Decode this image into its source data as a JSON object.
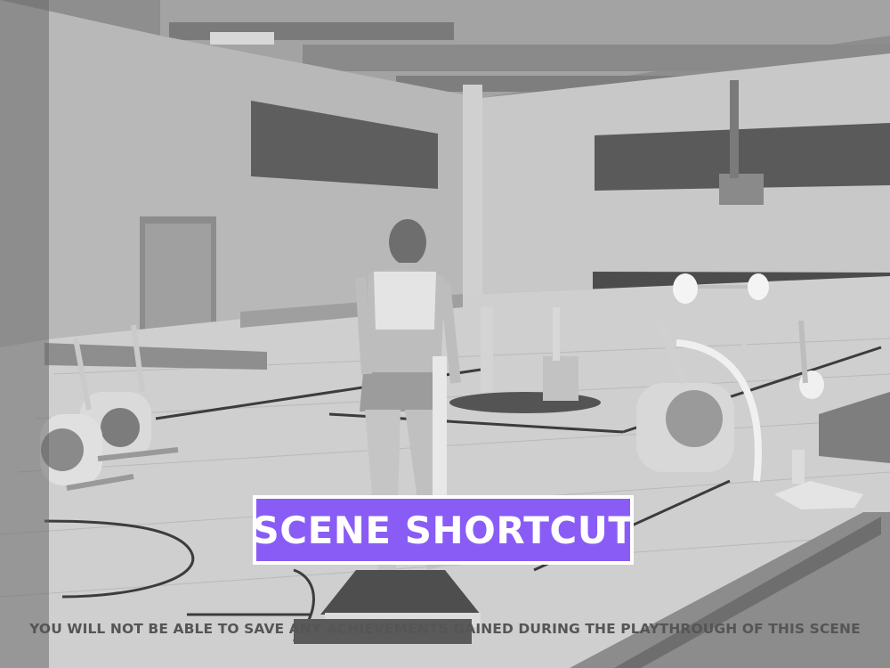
{
  "scene": {
    "shortcut_label": "SCENE SHORTCUT",
    "warning": "YOU WILL NOT BE ABLE TO SAVE ANY ACHIEVEMENTS GAINED DURING THE PLAYTHROUGH OF THIS SCENE"
  },
  "colors": {
    "accent": "#8a5cf6"
  }
}
